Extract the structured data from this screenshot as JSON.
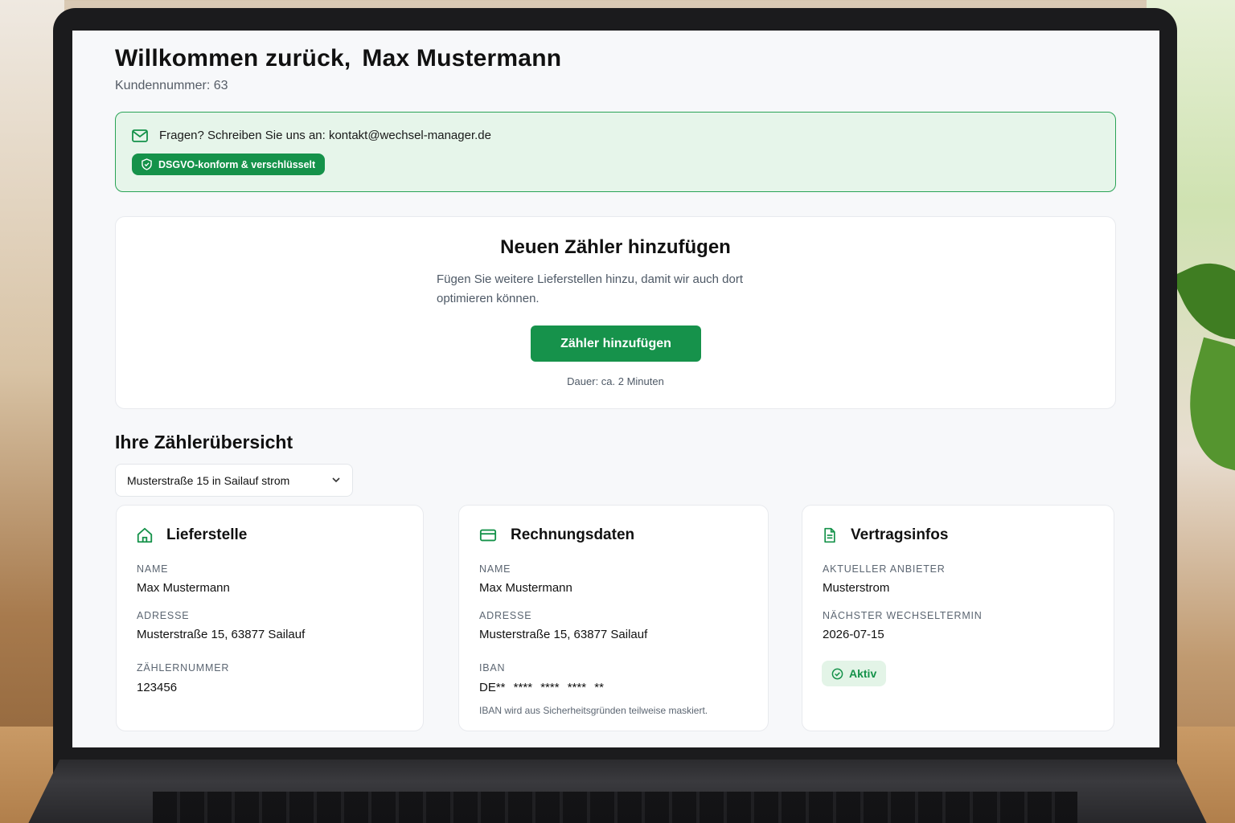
{
  "header": {
    "welcome_prefix": "Willkommen zurück,",
    "user_name": "Max Mustermann",
    "customer_number": "Kundennummer: 63"
  },
  "contact": {
    "icon": "mail-icon",
    "text": "Fragen? Schreiben Sie uns an: kontakt@wechsel-manager.de",
    "badge_icon": "shield-check-icon",
    "badge": "DSGVO-konform & verschlüsselt"
  },
  "add_meter": {
    "title": "Neuen Zähler hinzufügen",
    "description": "Fügen Sie weitere Lieferstellen hinzu, damit wir auch dort optimieren können.",
    "button": "Zähler hinzufügen",
    "duration": "Dauer: ca. 2 Minuten"
  },
  "overview": {
    "title": "Ihre Zählerübersicht",
    "selected_meter": "Musterstraße 15 in Sailauf strom"
  },
  "cards": {
    "supply": {
      "icon": "home-icon",
      "title": "Lieferstelle",
      "name_label": "NAME",
      "name": "Max Mustermann",
      "address_label": "ADRESSE",
      "address": "Musterstraße 15, 63877 Sailauf",
      "meter_label": "ZÄHLERNUMMER",
      "meter_number": "123456"
    },
    "billing": {
      "icon": "credit-card-icon",
      "title": "Rechnungsdaten",
      "name_label": "NAME",
      "name": "Max Mustermann",
      "address_label": "ADRESSE",
      "address": "Musterstraße 15, 63877 Sailauf",
      "iban_label": "IBAN",
      "iban": "DE** **** **** **** **",
      "iban_note": "IBAN wird aus Sicherheitsgründen teilweise maskiert."
    },
    "contract": {
      "icon": "document-icon",
      "title": "Vertragsinfos",
      "provider_label": "AKTUELLER ANBIETER",
      "provider": "Musterstrom",
      "next_switch_label": "NÄCHSTER WECHSELTERMIN",
      "next_switch": "2026-07-15",
      "status": "Aktiv"
    }
  },
  "colors": {
    "accent": "#16924b",
    "accent_light": "#e6f5ea",
    "text": "#111111",
    "muted": "#5c6672"
  }
}
